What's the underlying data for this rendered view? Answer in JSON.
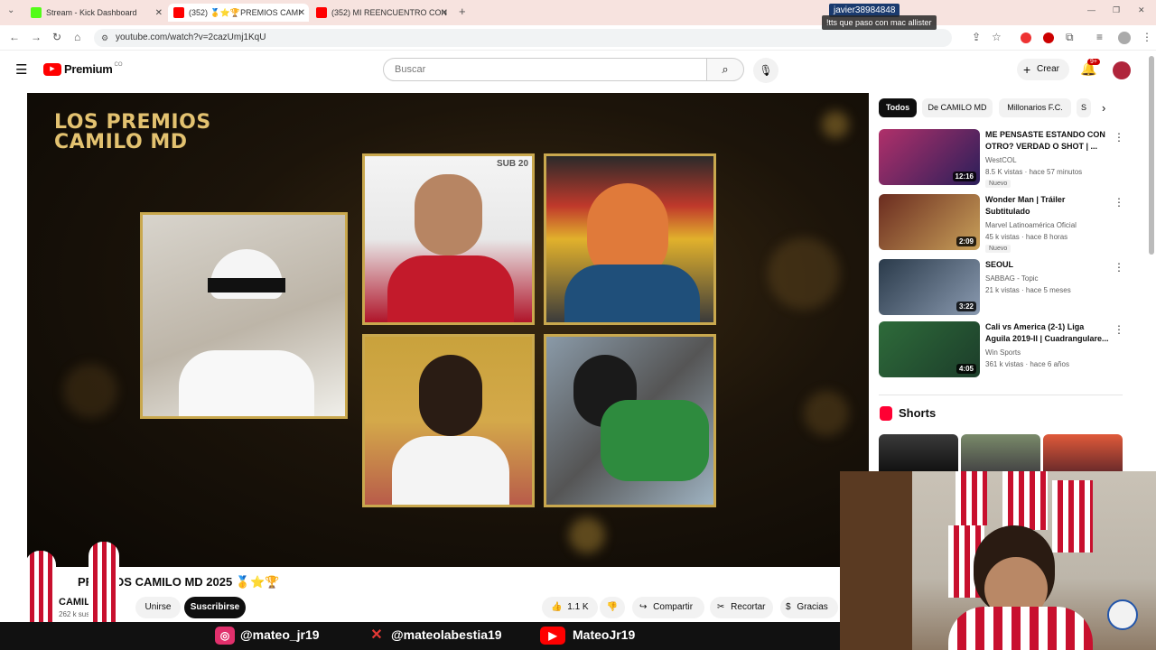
{
  "browser": {
    "tabs": [
      {
        "label": "Stream - Kick Dashboard",
        "color": "#53fc18"
      },
      {
        "label": "(352) 🥇⭐🏆PREMIOS CAMI",
        "color": "#ff0000"
      },
      {
        "label": "(352) MI REENCUENTRO CON",
        "color": "#ff0000"
      }
    ],
    "new_tab": "+",
    "url": "youtube.com/watch?v=2cazUmj1KqU"
  },
  "youtube": {
    "logo": "Premium",
    "logo_region": "CO",
    "search_placeholder": "Buscar",
    "create_label": "Crear",
    "notif_count": "9+"
  },
  "video": {
    "overlay_title": "LOS PREMIOS CAMILO MD",
    "photo_tag": "SUB 20",
    "title": "PREMIOS CAMILO MD 2025 🥇⭐🏆",
    "channel_name": "CAMILO",
    "subscribers": "262 k suscri",
    "join_label": "Unirse",
    "subscribe_label": "Suscribirse",
    "likes": "1.1 K",
    "share_label": "Compartir",
    "clip_label": "Recortar",
    "thanks_label": "Gracias"
  },
  "sidebar": {
    "chips": [
      "Todos",
      "De CAMILO MD",
      "Millonarios F.C.",
      "S"
    ],
    "recommendations": [
      {
        "title": "ME PENSASTE ESTANDO CON OTRO? VERDAD O SHOT | ...",
        "channel": "WestCOL",
        "meta": "8.5 K vistas · hace 57 minutos",
        "badge": "Nuevo",
        "duration": "12:16",
        "thumb_color": "#b0306a"
      },
      {
        "title": "Wonder Man | Tráiler Subtitulado",
        "channel": "Marvel Latinoamérica Oficial",
        "meta": "45 k vistas · hace 8 horas",
        "badge": "Nuevo",
        "duration": "2:09",
        "thumb_color": "#6a2b1f"
      },
      {
        "title": "SEOUL",
        "channel": "SABBAG - Topic",
        "meta": "21 k vistas · hace 5 meses",
        "badge": "",
        "duration": "3:22",
        "thumb_color": "#2a3a4a"
      },
      {
        "title": "Cali vs America (2-1) Liga Aguila 2019-II | Cuadrangulare...",
        "channel": "Win Sports",
        "meta": "361 k vistas · hace 6 años",
        "badge": "",
        "duration": "4:05",
        "thumb_color": "#2e6b3a"
      }
    ],
    "shorts_label": "Shorts"
  },
  "stream_overlay": {
    "chat_user": "javier38984848",
    "chat_message": "!tts que paso con mac allister",
    "instagram": "@mateo_jr19",
    "x": "@mateolabestia19",
    "youtube": "MateoJr19"
  }
}
